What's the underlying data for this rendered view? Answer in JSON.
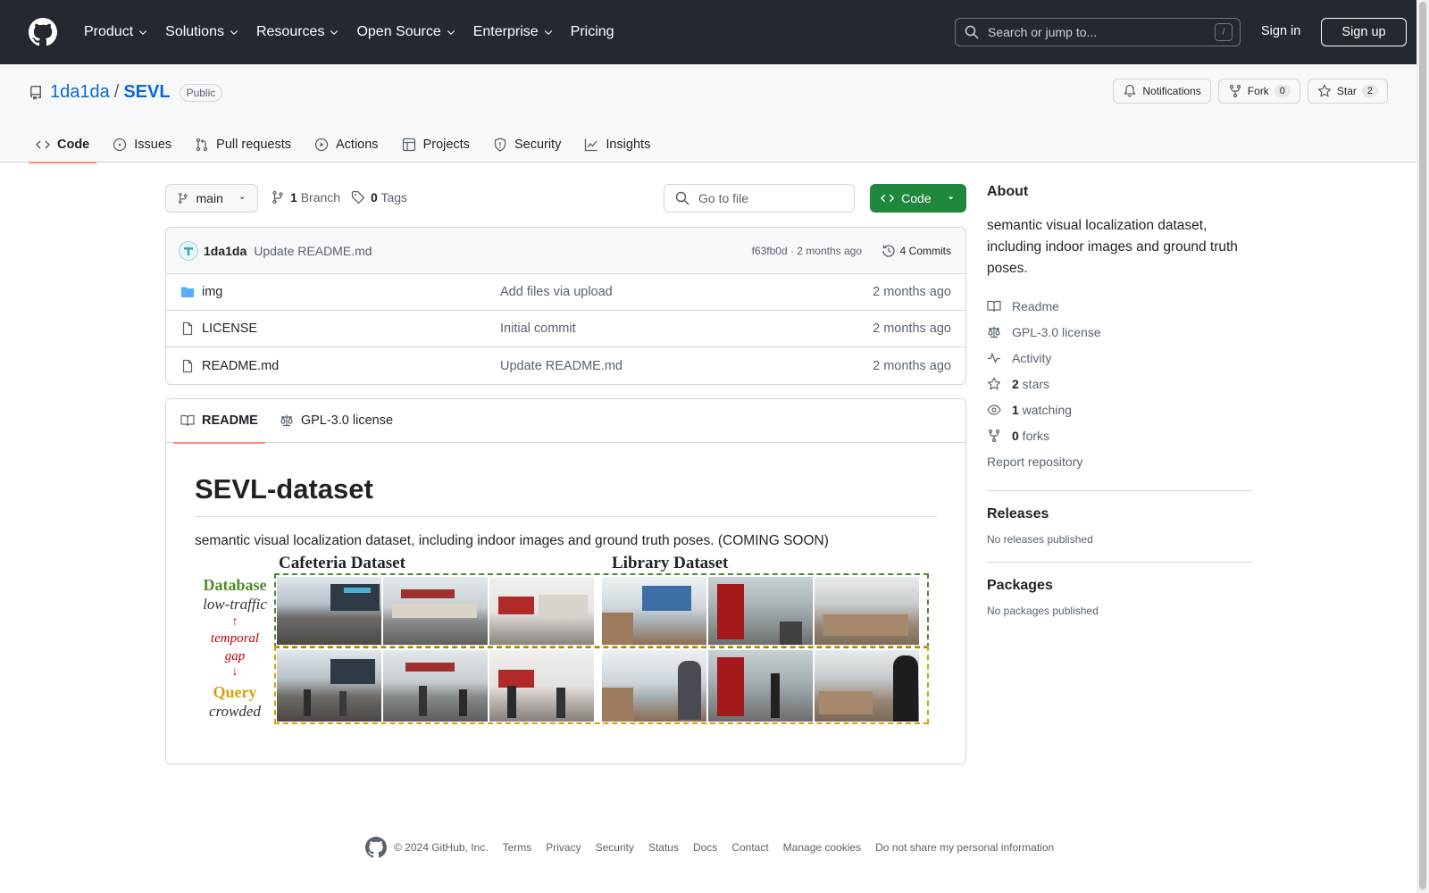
{
  "header": {
    "logo_icon": "github-mark-icon",
    "nav": [
      {
        "label": "Product",
        "has_caret": true
      },
      {
        "label": "Solutions",
        "has_caret": true
      },
      {
        "label": "Resources",
        "has_caret": true
      },
      {
        "label": "Open Source",
        "has_caret": true
      },
      {
        "label": "Enterprise",
        "has_caret": true
      },
      {
        "label": "Pricing",
        "has_caret": false
      }
    ],
    "search_placeholder": "Search or jump to...",
    "search_shortcut": "/",
    "sign_in": "Sign in",
    "sign_up": "Sign up"
  },
  "repo": {
    "owner": "1da1da",
    "separator": "/",
    "name": "SEVL",
    "visibility": "Public",
    "actions": {
      "notifications": "Notifications",
      "fork": "Fork",
      "fork_count": "0",
      "star": "Star",
      "star_count": "2"
    },
    "tabs": [
      {
        "label": "Code",
        "icon": "code-icon",
        "active": true
      },
      {
        "label": "Issues",
        "icon": "issue-opened-icon",
        "active": false
      },
      {
        "label": "Pull requests",
        "icon": "git-pull-request-icon",
        "active": false
      },
      {
        "label": "Actions",
        "icon": "play-icon",
        "active": false
      },
      {
        "label": "Projects",
        "icon": "table-icon",
        "active": false
      },
      {
        "label": "Security",
        "icon": "shield-icon",
        "active": false
      },
      {
        "label": "Insights",
        "icon": "graph-icon",
        "active": false
      }
    ]
  },
  "toolbar": {
    "branch": "main",
    "branch_count": "1",
    "branch_label": "Branch",
    "tag_count": "0",
    "tag_label": "Tags",
    "goto_placeholder": "Go to file",
    "code_button": "Code"
  },
  "commit": {
    "author": "1da1da",
    "message": "Update README.md",
    "meta": "f63fb0d · 2 months ago",
    "commits": "4 Commits"
  },
  "files": [
    {
      "name": "img",
      "type": "folder",
      "message": "Add files via upload",
      "date": "2 months ago"
    },
    {
      "name": "LICENSE",
      "type": "file",
      "message": "Initial commit",
      "date": "2 months ago"
    },
    {
      "name": "README.md",
      "type": "file",
      "message": "Update README.md",
      "date": "2 months ago"
    }
  ],
  "readme": {
    "tabs": [
      {
        "label": "README",
        "icon": "book-icon",
        "active": true
      },
      {
        "label": "GPL-3.0 license",
        "icon": "law-icon",
        "active": false
      }
    ],
    "title": "SEVL-dataset",
    "description": "semantic visual localization dataset, including indoor images and ground truth poses. (COMING SOON)",
    "figure": {
      "heading_left": "Cafeteria Dataset",
      "heading_right": "Library Dataset",
      "database_label": "Database",
      "database_sub": "low-traffic",
      "gap_label_1": "temporal",
      "gap_label_2": "gap",
      "query_label": "Query",
      "query_sub": "crowded",
      "colors": {
        "database": "#4c8c2b",
        "query": "#d4a106",
        "gap": "#c00000"
      }
    }
  },
  "sidebar": {
    "about_title": "About",
    "about_text": "semantic visual localization dataset, including indoor images and ground truth poses.",
    "links": [
      {
        "icon": "book-icon",
        "label": "Readme",
        "bold": ""
      },
      {
        "icon": "law-icon",
        "label": "GPL-3.0 license",
        "bold": ""
      },
      {
        "icon": "pulse-icon",
        "label": "Activity",
        "bold": ""
      },
      {
        "icon": "star-icon",
        "label": " stars",
        "bold": "2"
      },
      {
        "icon": "eye-icon",
        "label": " watching",
        "bold": "1"
      },
      {
        "icon": "repo-forked-icon",
        "label": " forks",
        "bold": "0"
      }
    ],
    "report": "Report repository",
    "releases_title": "Releases",
    "releases_text": "No releases published",
    "packages_title": "Packages",
    "packages_text": "No packages published"
  },
  "footer": {
    "copyright": "© 2024 GitHub, Inc.",
    "links": [
      "Terms",
      "Privacy",
      "Security",
      "Status",
      "Docs",
      "Contact",
      "Manage cookies",
      "Do not share my personal information"
    ]
  }
}
